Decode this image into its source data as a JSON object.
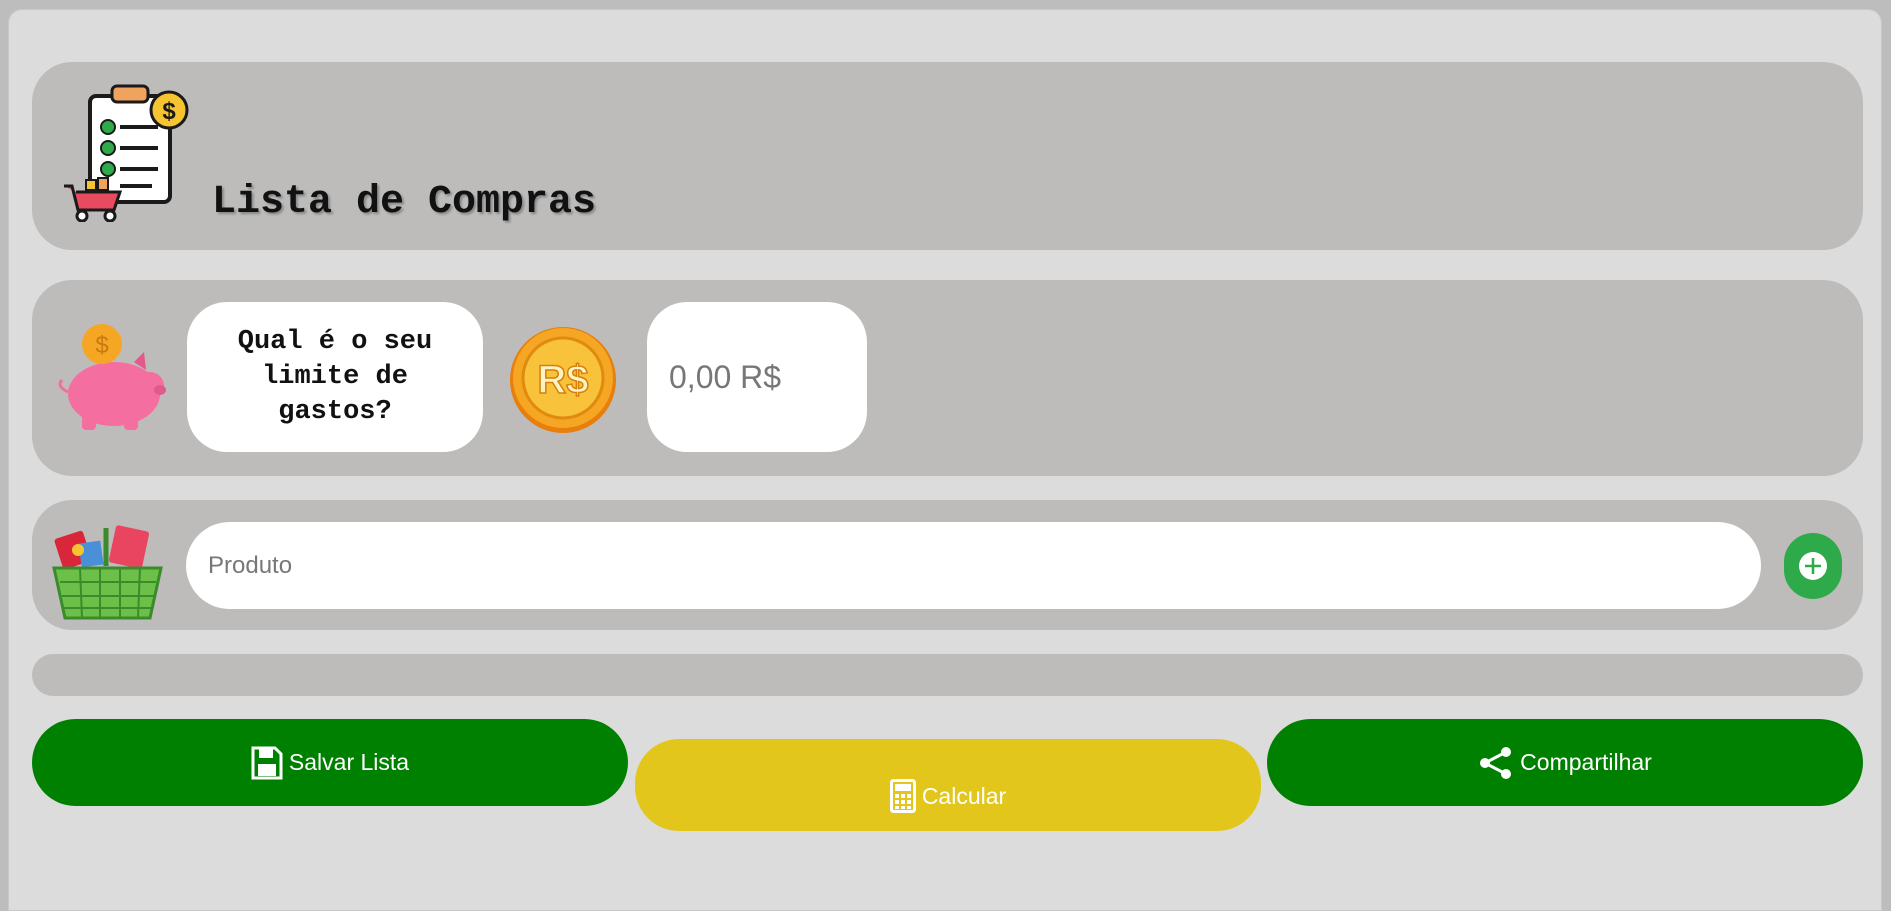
{
  "header": {
    "title": "Lista de Compras",
    "logo_icon": "shopping-list-clipboard-icon"
  },
  "budget": {
    "question": "Qual é o seu limite de gastos?",
    "limit_placeholder": "0,00 R$",
    "limit_value": "",
    "coin_label": "R$",
    "piggy_icon": "piggy-bank-icon",
    "coin_icon": "real-coin-icon"
  },
  "product": {
    "placeholder": "Produto",
    "value": "",
    "basket_icon": "grocery-basket-icon",
    "add_icon": "plus-circle-icon"
  },
  "actions": {
    "save_label": "Salvar Lista",
    "calc_label": "Calcular",
    "share_label": "Compartilhar"
  },
  "colors": {
    "background": "#dcdcdc",
    "panel": "#bdbcbb",
    "save_button": "#008000",
    "share_button": "#008000",
    "calc_button": "#e3c61b",
    "add_button": "#2faa4a"
  }
}
